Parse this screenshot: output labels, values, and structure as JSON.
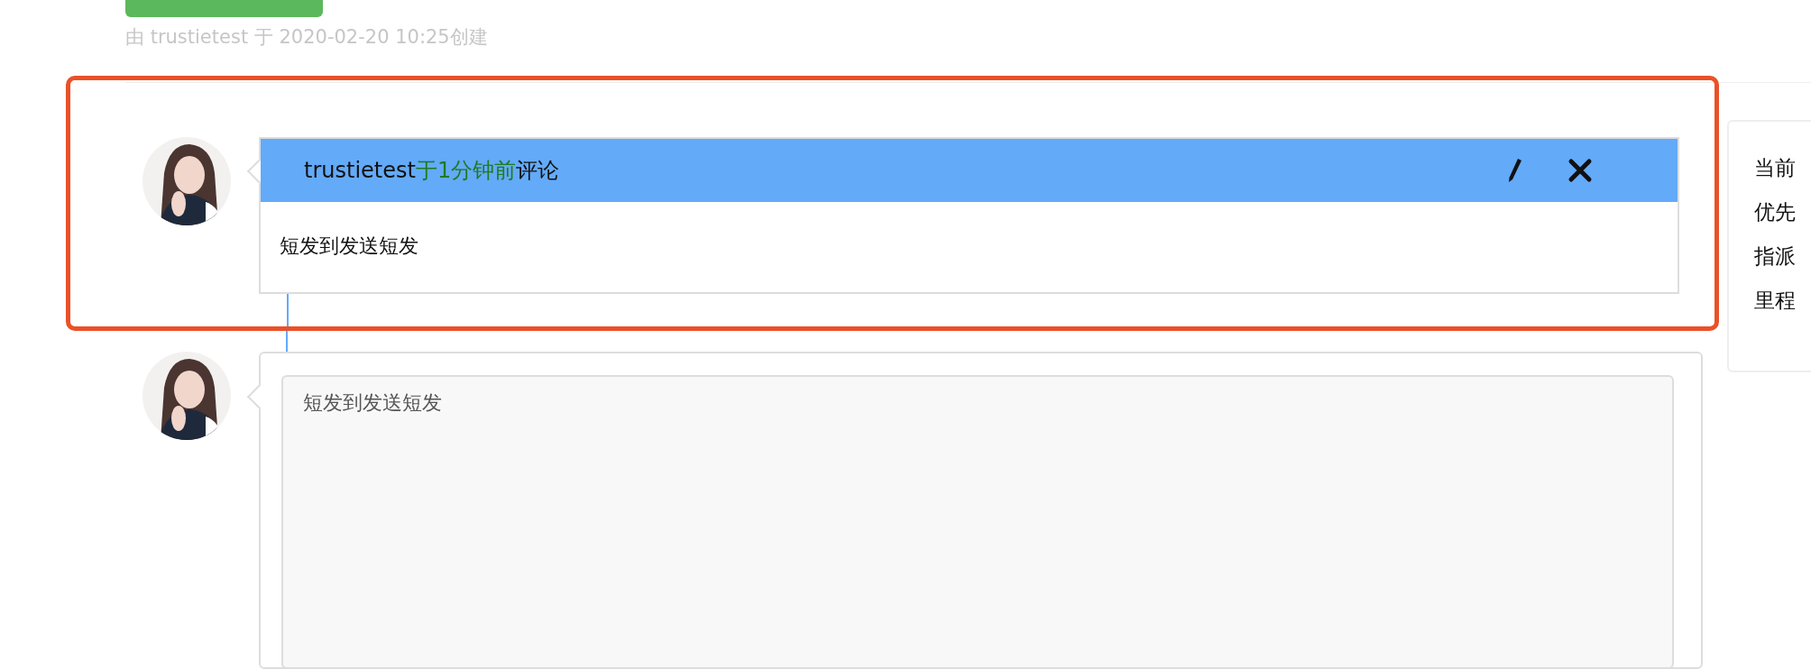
{
  "meta": "由 trustietest 于 2020-02-20 10:25创建",
  "comment": {
    "author": "trustietest",
    "time": "于1分钟前",
    "action": "评论",
    "body": "短发到发送短发"
  },
  "reply": {
    "value": "短发到发送短发"
  },
  "side_panel": {
    "labels": [
      "当前",
      "优先",
      "指派",
      "里程"
    ]
  }
}
